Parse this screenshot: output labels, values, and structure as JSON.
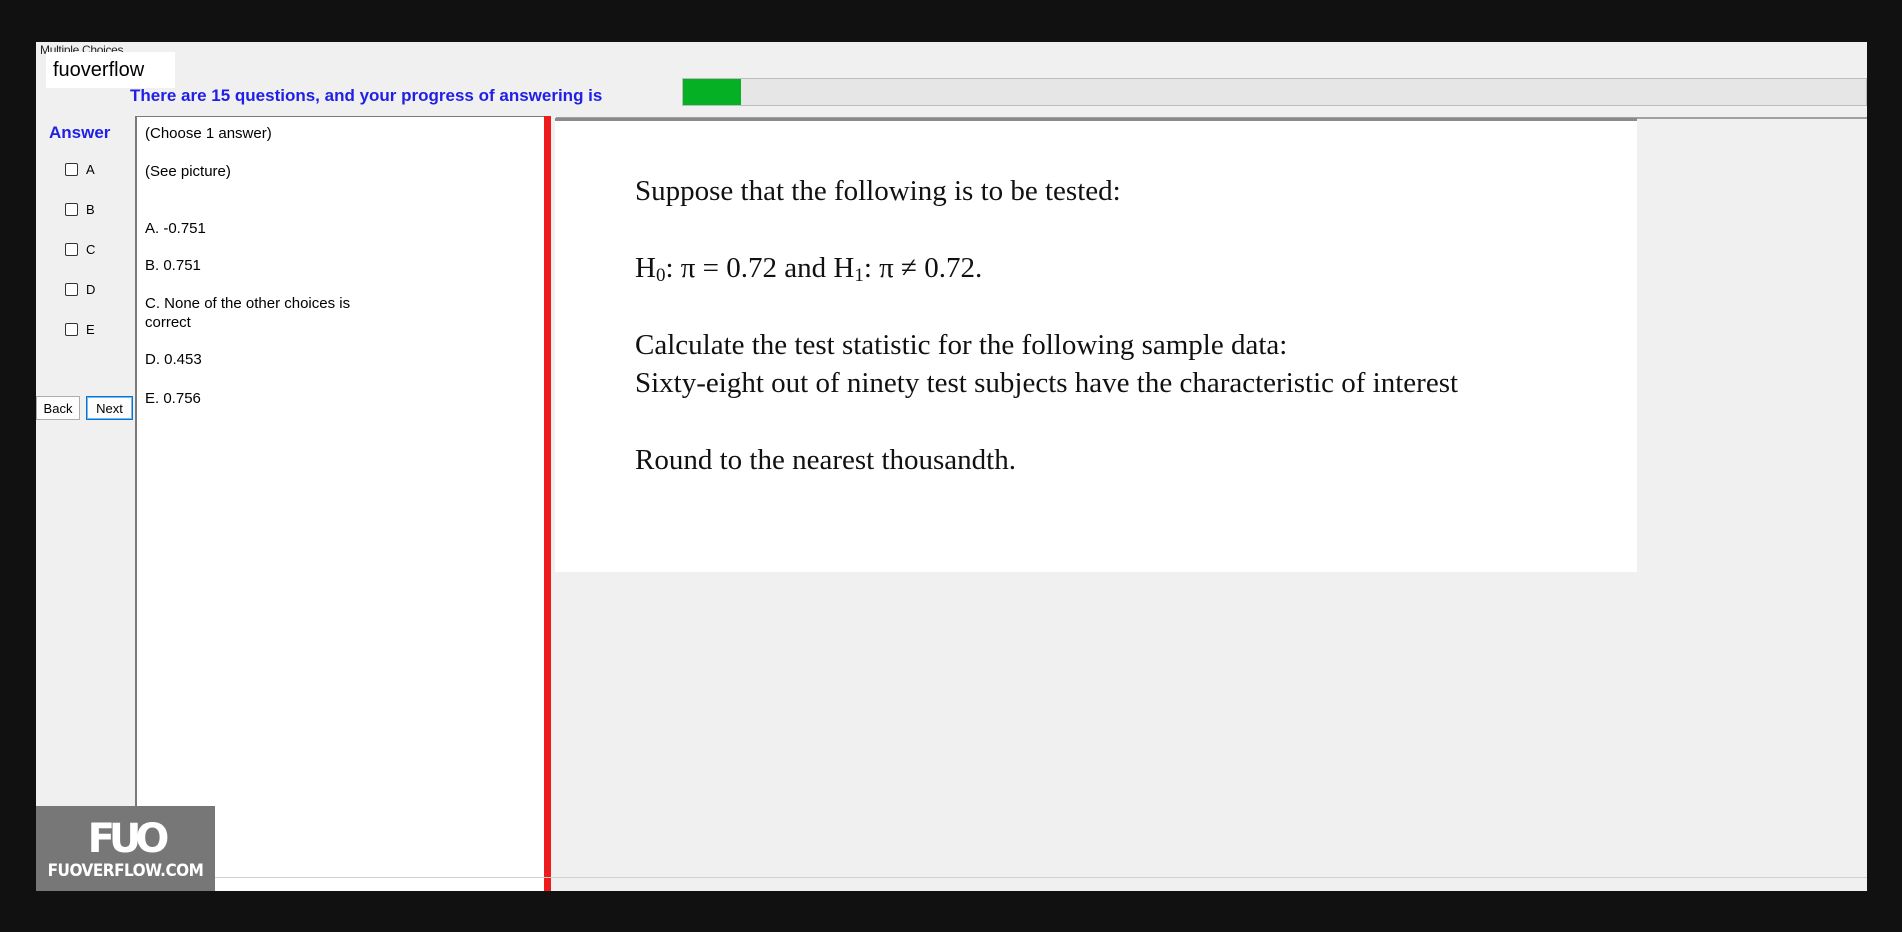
{
  "window": {
    "title": "Multiple Choices"
  },
  "brand": {
    "label": "fuoverflow"
  },
  "progress": {
    "text": "There are 15 questions, and your progress of answering is",
    "fraction": 0.049
  },
  "answer": {
    "label": "Answer",
    "options": [
      "A",
      "B",
      "C",
      "D",
      "E"
    ]
  },
  "nav": {
    "back_label": "Back",
    "next_label": "Next"
  },
  "question": {
    "instruction": "(Choose 1 answer)",
    "see_picture": "(See picture)",
    "choices": [
      "A.  -0.751",
      "B.  0.751",
      "C.  None of the other choices is correct",
      "D.  0.453",
      "E.  0.756"
    ]
  },
  "picture": {
    "line1": "Suppose that the following is  to be tested:",
    "h0_pre": "H",
    "h0_sub": "0",
    "h0_mid": ": π = 0.72 and H",
    "h1_sub": "1",
    "h1_post": ": π ≠ 0.72.",
    "line3": "Calculate the test statistic  for the following sample data:",
    "line4": "Sixty-eight out of ninety test subjects have the characteristic  of interest",
    "line5": "Round to the nearest  thousandth."
  },
  "watermark": {
    "mark": "FUO",
    "text": "FUOVERFLOW.COM"
  }
}
